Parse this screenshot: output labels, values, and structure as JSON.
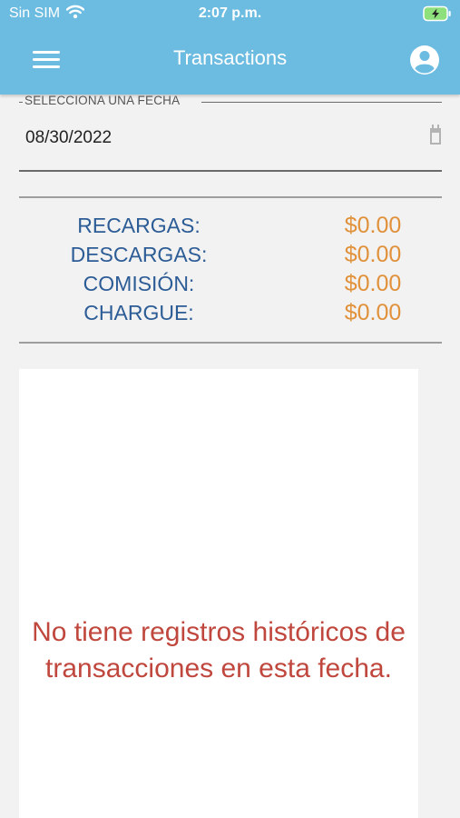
{
  "status_bar": {
    "carrier": "Sin SIM",
    "time": "2:07 p.m."
  },
  "header": {
    "title": "Transactions"
  },
  "date_field": {
    "label": "SELECCIONA UNA FECHA",
    "value": "08/30/2022"
  },
  "summary": [
    {
      "label": "RECARGAS:",
      "value": "$0.00"
    },
    {
      "label": "DESCARGAS:",
      "value": "$0.00"
    },
    {
      "label": "COMISIÓN:",
      "value": "$0.00"
    },
    {
      "label": "CHARGUE:",
      "value": "$0.00"
    }
  ],
  "empty_state": {
    "message": "No tiene registros históricos de transacciones en esta fecha."
  },
  "icons": {
    "menu": "hamburger-icon",
    "profile": "user-circle-icon",
    "calendar": "calendar-icon",
    "wifi": "wifi-icon",
    "battery": "battery-charging-icon"
  },
  "colors": {
    "header": "#6cbbe0",
    "label": "#2c5c96",
    "amount": "#e0913a",
    "empty_message": "#c0473d",
    "background": "#f2f2f2"
  }
}
